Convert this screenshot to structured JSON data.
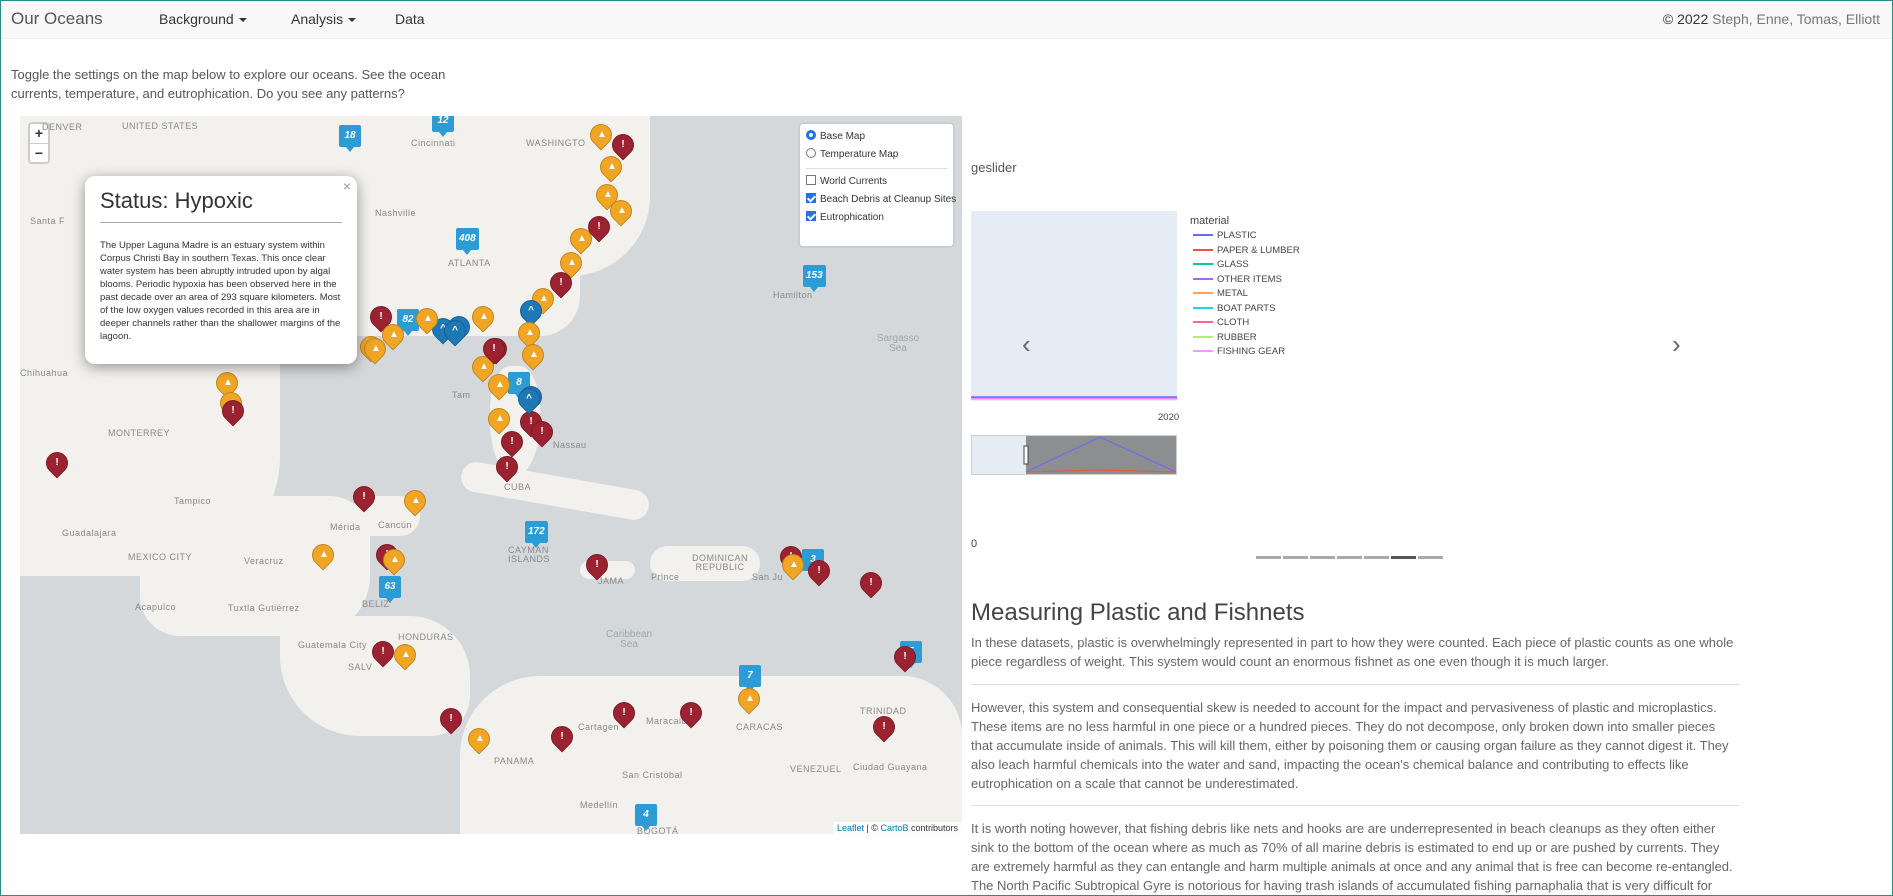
{
  "nav": {
    "brand": "Our Oceans",
    "items": [
      {
        "label": "Background"
      },
      {
        "label": "Analysis"
      },
      {
        "label": "Data"
      }
    ],
    "copyright_symbol": "© 2022",
    "copyright_names": "Steph, Enne, Tomas, Elliott"
  },
  "intro": "Toggle the settings on the map below to explore our oceans. See the ocean currents, temperature, and eutrophication. Do you see any patterns?",
  "map": {
    "zoom_in": "+",
    "zoom_out": "−",
    "labels": {
      "denver": "DENVER",
      "us": "UNITED STATES",
      "cincinnati": "Cincinnati",
      "washington": "WASHINGTO",
      "santa_fe": "Santa F",
      "nashville": "Nashville",
      "atlanta": "ATLANTA",
      "hamilton": "Hamilton",
      "chihuahua": "Chihuahua",
      "monterrey": "MONTERREY",
      "nassau": "Nassau",
      "cuba": "CUBA",
      "tampico": "Tampico",
      "merida": "Mérida",
      "cancun": "Cancún",
      "guadalajara": "Guadalajara",
      "mexico_city": "MEXICO CITY",
      "veracruz": "Veracruz",
      "acapulco": "Acapulco",
      "tuxtla": "Tuxtla Gutiérrez",
      "belize": "BELIZ",
      "honduras": "HONDURAS",
      "guatemala": "Guatemala City",
      "salvador": "SALV",
      "cayman": "CAYMAN ISLANDS",
      "jamaica": "JAMA",
      "dominican": "DOMINICAN REPUBLIC",
      "san_juan": "San Ju",
      "prince": "Prince",
      "panama": "PANAMA",
      "cartagena": "Cartagen",
      "maracaibo": "Maracaibo",
      "caracas": "CARACAS",
      "venezuela": "VENEZUEL",
      "san_cristobal": "San Cristóbal",
      "medellin": "Medellín",
      "bogota": "BOGOTÁ",
      "trinidad": "TRINIDAD",
      "guayana": "Ciudad Guayana",
      "sargasso": "Sargasso Sea",
      "caribbean": "Caribbean Sea",
      "tam": "Tam"
    },
    "clusters": [
      "18",
      "12",
      "408",
      "153",
      "82",
      "8",
      "172",
      "63",
      "7",
      "4",
      "3",
      "5"
    ],
    "popup": {
      "title": "Status: Hypoxic",
      "close": "×",
      "body": "The Upper Laguna Madre is an estuary system within Corpus Christi Bay in southern Texas. This once clear water system has been abruptly intruded upon by algal blooms. Periodic hypoxia has been observed here in the past decade over an area of 293 square kilometers. Most of the low oxygen values recorded in this area are in deeper channels rather than the shallower margins of the lagoon."
    },
    "layers": {
      "base": [
        {
          "label": "Base Map",
          "checked": true
        },
        {
          "label": "Temperature Map",
          "checked": false
        }
      ],
      "overlays": [
        {
          "label": "World Currents",
          "checked": false
        },
        {
          "label": "Beach Debris at Cleanup Sites",
          "checked": true
        },
        {
          "label": "Eutrophication",
          "checked": true
        }
      ]
    },
    "attribution": {
      "leaflet": "Leaflet",
      "sep": " | © ",
      "carto": "CartoB",
      "contrib": " contributors"
    }
  },
  "slider": {
    "title": "geslider",
    "legend_title": "material",
    "legend": [
      {
        "name": "PLASTIC",
        "color": "#636efa"
      },
      {
        "name": "PAPER & LUMBER",
        "color": "#ef553b"
      },
      {
        "name": "GLASS",
        "color": "#00cc96"
      },
      {
        "name": "OTHER ITEMS",
        "color": "#ab63fa"
      },
      {
        "name": "METAL",
        "color": "#ffa15a"
      },
      {
        "name": "BOAT PARTS",
        "color": "#19d3f3"
      },
      {
        "name": "CLOTH",
        "color": "#ff6692"
      },
      {
        "name": "RUBBER",
        "color": "#b6e880"
      },
      {
        "name": "FISHING GEAR",
        "color": "#ff97ff"
      }
    ],
    "year_tick": "2020",
    "zero_tick": "0",
    "prev": "‹",
    "next": "›",
    "indicators": 7,
    "active_indicator": 5
  },
  "article": {
    "heading": "Measuring Plastic and Fishnets",
    "p1": "In these datasets, plastic is overwhelmingly represented in part to how they were counted. Each piece of plastic counts as one whole piece regardless of weight. This system would count an enormous fishnet as one even though it is much larger.",
    "p2": "However, this system and consequential skew is needed to account for the impact and pervasiveness of plastic and microplastics. These items are no less harmful in one piece or a hundred pieces. They do not decompose, only broken down into smaller pieces that accumulate inside of animals. This will kill them, either by poisoning them or causing organ failure as they cannot digest it. They also leach harmful chemicals into the water and sand, impacting the ocean's chemical balance and contributing to effects like eutrophication on a scale that cannot be underestimated.",
    "p3": "It is worth noting however, that fishing debris like nets and hooks are are underrepresented in beach cleanups as they often either sink to the bottom of the ocean where as much as 70% of all marine debris is estimated to end up or are pushed by currents. They are extremely harmful as they can entangle and harm multiple animals at once and any animal that is free can become re-entangled. The North Pacific Subtropical Gyre is notorious for having trash islands of accumulated fishing parnaphalia that is very difficult for scientists"
  }
}
